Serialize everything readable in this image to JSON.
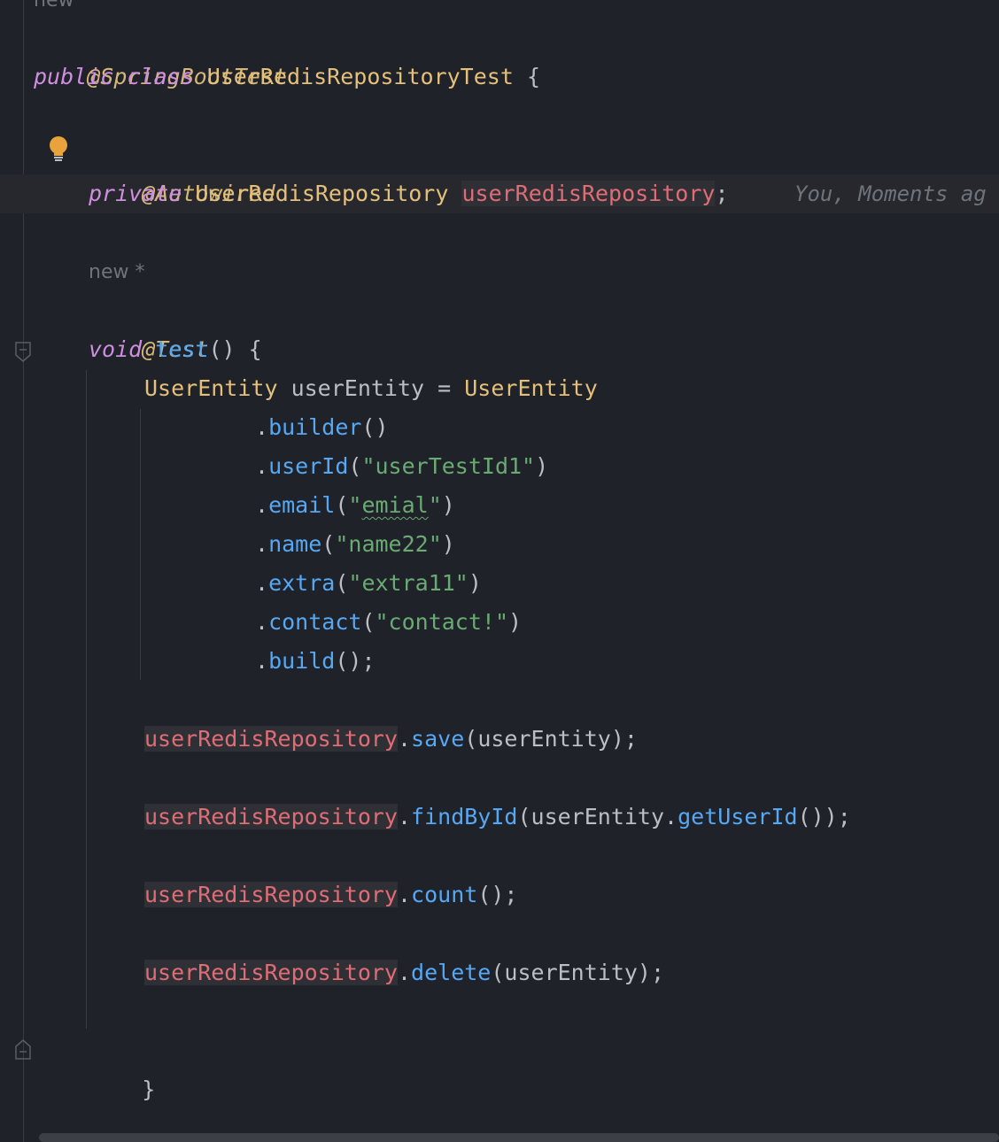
{
  "code": {
    "top_hint": "new",
    "annotation_class": "@SpringBootTest",
    "kw_public": "public",
    "kw_class": "class",
    "class_name": "UserRedisRepositoryTest",
    "open_brace": "{",
    "annotation_autowired": "@Autowired",
    "kw_private": "private",
    "field_type": "UserRedisRepository",
    "field_name": "userRedisRepository",
    "semicolon": ";",
    "blame": "You, Moments ag",
    "new_hint": "new *",
    "annotation_test": "@Test",
    "kw_void": "void",
    "method_name": "test",
    "method_sig_rest": "() {",
    "entity_type": "UserEntity",
    "entity_var": "userEntity",
    "assign": " = ",
    "entity_type2": "UserEntity",
    "builder_chain": [
      {
        "dot": ".",
        "method": "builder",
        "open": "(",
        "arg": "",
        "close": ")"
      },
      {
        "dot": ".",
        "method": "userId",
        "open": "(",
        "arg": "\"userTestId1\"",
        "close": ")"
      },
      {
        "dot": ".",
        "method": "email",
        "open": "(",
        "arg_pre": "\"",
        "arg_word": "emial",
        "arg_post": "\"",
        "close": ")"
      },
      {
        "dot": ".",
        "method": "name",
        "open": "(",
        "arg": "\"name22\"",
        "close": ")"
      },
      {
        "dot": ".",
        "method": "extra",
        "open": "(",
        "arg": "\"extra11\"",
        "close": ")"
      },
      {
        "dot": ".",
        "method": "contact",
        "open": "(",
        "arg": "\"contact!\"",
        "close": ")"
      },
      {
        "dot": ".",
        "method": "build",
        "open": "(",
        "arg": "",
        "close": ");"
      }
    ],
    "calls": [
      {
        "receiver": "userRedisRepository",
        "dot": ".",
        "method": "save",
        "args": "(userEntity);"
      },
      {
        "receiver": "userRedisRepository",
        "dot": ".",
        "method": "findById",
        "args_pre": "(userEntity.",
        "inner_method": "getUserId",
        "args_post": "());"
      },
      {
        "receiver": "userRedisRepository",
        "dot": ".",
        "method": "count",
        "args": "();"
      },
      {
        "receiver": "userRedisRepository",
        "dot": ".",
        "method": "delete",
        "args": "(userEntity);"
      }
    ],
    "method_close": "}",
    "class_close": "}"
  },
  "colors": {
    "background": "#1f2228",
    "keyword": "#cf8ee0",
    "annotation": "#d5b778",
    "class": "#e5c07b",
    "function": "#56a8f5",
    "string": "#6aab73",
    "field": "#e06c75",
    "text": "#bcbec4",
    "hint": "#6f737a"
  },
  "icons": {
    "bulb": "lightbulb-icon",
    "fold": "fold-marker-icon"
  }
}
